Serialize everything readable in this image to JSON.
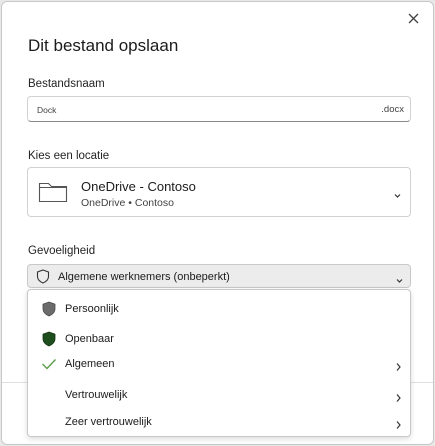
{
  "dialog": {
    "title": "Dit bestand opslaan"
  },
  "filename": {
    "label": "Bestandsnaam",
    "value": "Dock",
    "extension": ".docx"
  },
  "location": {
    "label": "Kies een locatie",
    "name": "OneDrive - Contoso",
    "path": "OneDrive • Contoso",
    "icon": "folder-icon"
  },
  "sensitivity": {
    "label": "Gevoeligheid",
    "selected": "Algemene werknemers (onbeperkt)",
    "options": [
      {
        "label": "Persoonlijk",
        "icon": "shield-gray-icon",
        "submenu": false
      },
      {
        "label": "Openbaar",
        "icon": "shield-green-icon",
        "submenu": false
      },
      {
        "label": "Algemeen",
        "icon": "check-icon",
        "submenu": true
      },
      {
        "label": "Vertrouwelijk",
        "icon": "",
        "submenu": true
      },
      {
        "label": "Zeer vertrouwelijk",
        "icon": "",
        "submenu": true
      }
    ]
  },
  "colors": {
    "check": "#5a9a4a",
    "shield_gray": "#6b6b6b",
    "shield_green": "#1e4d1e"
  }
}
